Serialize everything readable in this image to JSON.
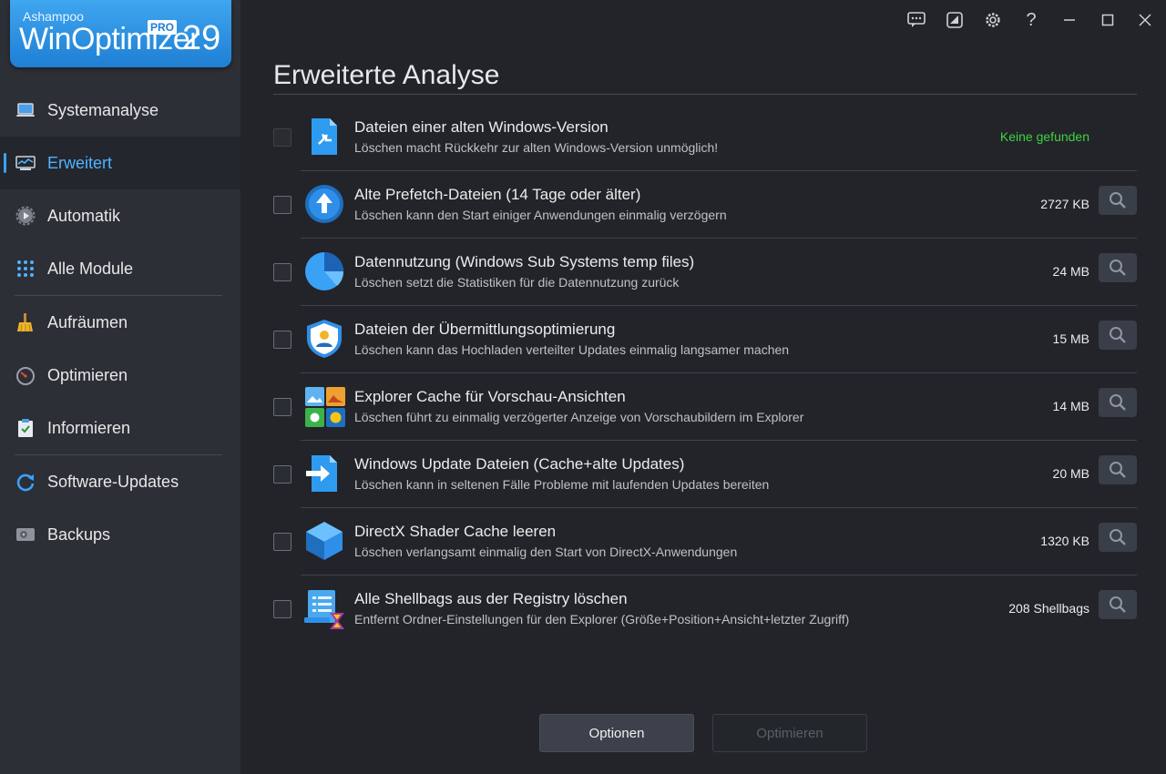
{
  "logo": {
    "brand": "Ashampoo",
    "product": "WinOptimizer",
    "edition": "PRO",
    "version": "29"
  },
  "sidebar": {
    "items": [
      {
        "label": "Systemanalyse",
        "icon": "laptop-icon"
      },
      {
        "label": "Erweitert",
        "icon": "chart-monitor-icon",
        "active": true
      },
      {
        "label": "Automatik",
        "icon": "play-gear-icon"
      },
      {
        "label": "Alle Module",
        "icon": "grid-dots-icon"
      },
      {
        "label": "Aufräumen",
        "icon": "broom-icon"
      },
      {
        "label": "Optimieren",
        "icon": "gauge-icon"
      },
      {
        "label": "Informieren",
        "icon": "clipboard-check-icon"
      },
      {
        "label": "Software-Updates",
        "icon": "refresh-icon"
      },
      {
        "label": "Backups",
        "icon": "hard-drive-icon"
      }
    ]
  },
  "titlebar": {
    "icons": [
      "feedback-icon",
      "skin-icon",
      "gear-icon",
      "help-icon",
      "minimize-icon",
      "maximize-icon",
      "close-icon"
    ]
  },
  "main": {
    "title": "Erweiterte Analyse",
    "rows": [
      {
        "title": "Dateien einer alten Windows-Version",
        "subtitle": "Löschen macht Rückkehr zur alten Windows-Version unmöglich!",
        "size": "Keine gefunden",
        "disabled": true,
        "icon": "old-windows-file-icon"
      },
      {
        "title": "Alte Prefetch-Dateien (14 Tage oder älter)",
        "subtitle": "Löschen kann den Start einiger Anwendungen einmalig verzögern",
        "size": "2727 KB",
        "icon": "prefetch-arrow-icon"
      },
      {
        "title": "Datennutzung (Windows Sub Systems temp files)",
        "subtitle": "Löschen setzt die Statistiken für die Datennutzung zurück",
        "size": "24 MB",
        "icon": "pie-chart-icon"
      },
      {
        "title": "Dateien der Übermittlungsoptimierung",
        "subtitle": "Löschen kann das Hochladen verteilter Updates einmalig langsamer machen",
        "size": "15 MB",
        "icon": "user-shield-icon"
      },
      {
        "title": "Explorer Cache für Vorschau-Ansichten",
        "subtitle": "Löschen führt zu einmalig verzögerter Anzeige von Vorschaubildern im Explorer",
        "size": "14 MB",
        "icon": "thumbnail-grid-icon"
      },
      {
        "title": "Windows Update Dateien (Cache+alte Updates)",
        "subtitle": "Löschen kann in seltenen Fälle Probleme mit laufenden Updates bereiten",
        "size": "20 MB",
        "icon": "update-file-icon"
      },
      {
        "title": "DirectX Shader Cache leeren",
        "subtitle": "Löschen verlangsamt einmalig den Start von DirectX-Anwendungen",
        "size": "1320 KB",
        "icon": "cube-icon"
      },
      {
        "title": "Alle Shellbags aus der Registry löschen",
        "subtitle": "Entfernt Ordner-Einstellungen für den Explorer (Größe+Position+Ansicht+letzter Zugriff)",
        "size": "208 Shellbags",
        "icon": "registry-hourglass-icon"
      }
    ]
  },
  "buttons": {
    "options": "Optionen",
    "optimize": "Optimieren"
  },
  "colors": {
    "accent": "#3aa2ff",
    "found_none": "#3fd33f",
    "background": "#222429",
    "sidebar": "#2c2f36"
  }
}
